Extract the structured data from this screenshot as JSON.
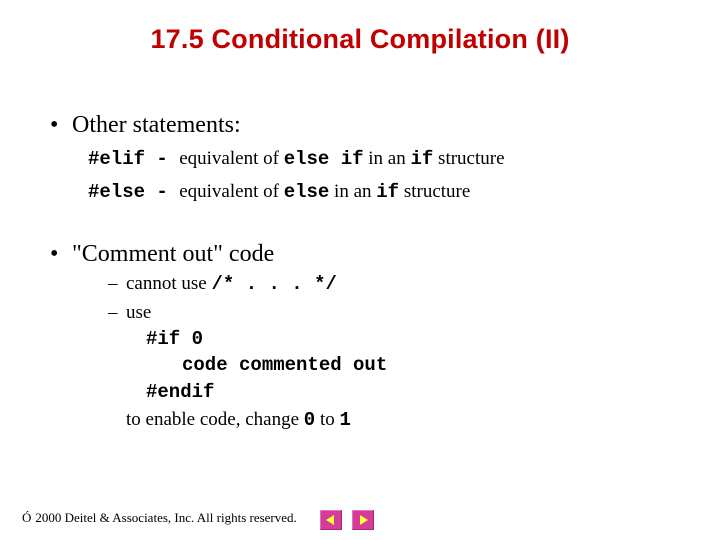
{
  "title": "17.5   Conditional Compilation (II)",
  "bullets": {
    "b1": {
      "label": "Other statements:",
      "line1": {
        "c1": "#elif - ",
        "t1": "equivalent of ",
        "c2": "else if",
        "t2": " in an ",
        "c3": "if",
        "t3": " structure"
      },
      "line2": {
        "c1": "#else - ",
        "t1": "equivalent of ",
        "c2": "else",
        "t2": " in an ",
        "c3": "if",
        "t3": " structure"
      }
    },
    "b2": {
      "label": "\"Comment out\" code",
      "d1": {
        "t1": "cannot use ",
        "c1": "/* . . . */"
      },
      "d2": {
        "t1": "use"
      },
      "code": {
        "l1": "#if 0",
        "l2": "code commented out",
        "l3": "#endif"
      },
      "tail": {
        "t1": "to enable code, change ",
        "c1": "0",
        "t2": " to ",
        "c2": "1"
      }
    }
  },
  "footer": {
    "mark": "Ó",
    "text": " 2000 Deitel & Associates, Inc.  All rights reserved."
  }
}
